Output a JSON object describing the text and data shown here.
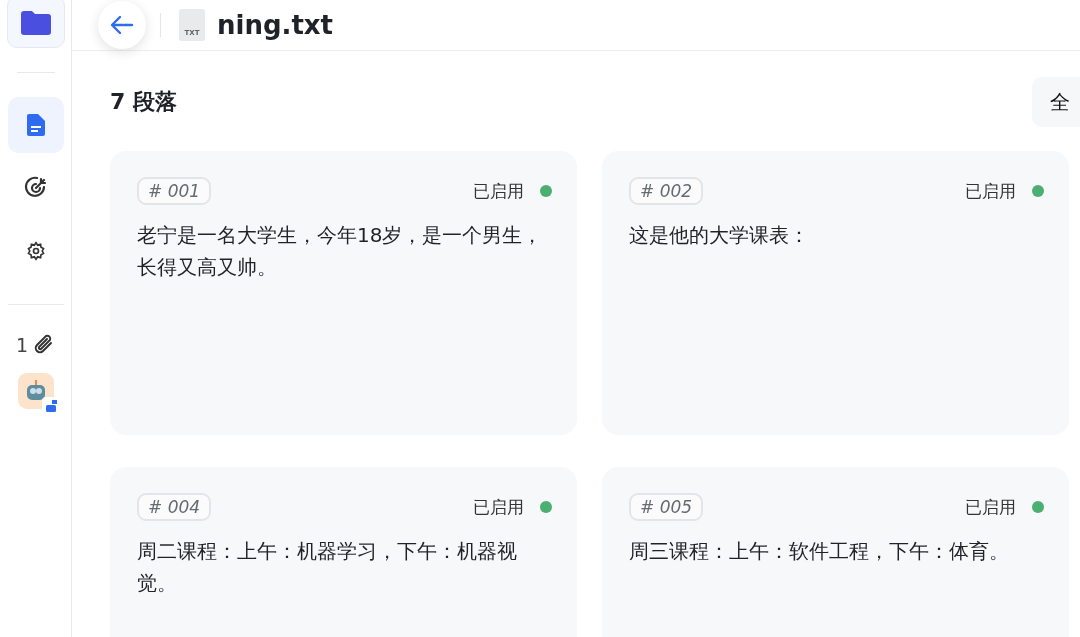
{
  "sidebar": {
    "items": [
      {
        "kind": "document",
        "selected": true
      },
      {
        "kind": "target",
        "selected": false
      },
      {
        "kind": "settings",
        "selected": false
      }
    ],
    "attachments": {
      "count": "1"
    }
  },
  "header": {
    "file_badge": "TXT",
    "title": "ning.txt"
  },
  "section": {
    "title": "7 段落",
    "filter_button": "全"
  },
  "paragraphs": [
    {
      "number": "# 001",
      "status": "已启用",
      "enabled": true,
      "text": "老宁是一名大学生，今年18岁，是一个男生，长得又高又帅。"
    },
    {
      "number": "# 002",
      "status": "已启用",
      "enabled": true,
      "text": "这是他的大学课表："
    },
    {
      "number": "# 004",
      "status": "已启用",
      "enabled": true,
      "text": "周二课程：上午：机器学习，下午：机器视觉。"
    },
    {
      "number": "# 005",
      "status": "已启用",
      "enabled": true,
      "text": "周三课程：上午：软件工程，下午：体育。"
    }
  ]
}
